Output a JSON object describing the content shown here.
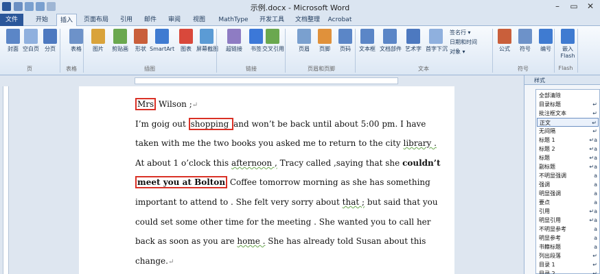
{
  "window": {
    "title": "示例.docx - Microsoft Word"
  },
  "tabs": [
    "文件",
    "开始",
    "插入",
    "页面布局",
    "引用",
    "邮件",
    "审阅",
    "视图",
    "MathType",
    "开发工具",
    "文档整理",
    "Acrobat"
  ],
  "ribbon": {
    "groups": [
      {
        "label": "页",
        "buttons": [
          "封面",
          "空白页",
          "分页"
        ]
      },
      {
        "label": "表格",
        "buttons": [
          "表格"
        ]
      },
      {
        "label": "插图",
        "buttons": [
          "图片",
          "剪贴画",
          "形状",
          "SmartArt",
          "图表",
          "屏幕截图"
        ]
      },
      {
        "label": "链接",
        "buttons": [
          "超链接",
          "书签",
          "交叉引用"
        ]
      },
      {
        "label": "页眉和页脚",
        "buttons": [
          "页眉",
          "页脚",
          "页码"
        ]
      },
      {
        "label": "文本",
        "buttons": [
          "文本框",
          "文档部件",
          "艺术字",
          "首字下沉"
        ],
        "small": [
          "签名行 ▾",
          "日期和时间",
          "对象 ▾"
        ]
      },
      {
        "label": "符号",
        "buttons": [
          "公式",
          "符号",
          "编号"
        ]
      },
      {
        "label": "Flash",
        "buttons": [
          "嵌入\nFlash"
        ]
      }
    ]
  },
  "document": {
    "lines": [
      [
        {
          "t": "Mrs",
          "box": true
        },
        {
          "t": " Wilson ;"
        },
        {
          "t": "↵",
          "pm": true
        }
      ],
      [
        {
          "t": "I’m goig out "
        },
        {
          "t": "shopping ",
          "box": true
        },
        {
          "t": " and won’t be back until about 5:00 pm. I have"
        }
      ],
      [
        {
          "t": "taken with me the two books you asked me to return to the city "
        },
        {
          "t": "library .",
          "sq": true
        }
      ],
      [
        {
          "t": "At about 1 o’clock this "
        },
        {
          "t": "afternoon ,",
          "sq": true
        },
        {
          "t": " Tracy called ,saying that she "
        },
        {
          "t": "couldn’t",
          "b": true
        }
      ],
      [
        {
          "t": "meet you at Bolton",
          "box": true,
          "b": true
        },
        {
          "t": " Coffee tomorrow morning as she has something"
        }
      ],
      [
        {
          "t": "important to attend to . She felt very sorry about "
        },
        {
          "t": "that ;",
          "sq": true
        },
        {
          "t": " but said that you"
        }
      ],
      [
        {
          "t": "could set some other time for the meeting .  She wanted you to call her"
        }
      ],
      [
        {
          "t": "back as soon as you are "
        },
        {
          "t": "home .",
          "sq": true
        },
        {
          "t": " She has already told Susan about this"
        }
      ],
      [
        {
          "t": "change."
        },
        {
          "t": "↵",
          "pm": true
        }
      ]
    ]
  },
  "styles_pane": {
    "title": "样式",
    "items": [
      {
        "name": "全部清除",
        "mark": ""
      },
      {
        "name": "目录标题",
        "mark": "↵"
      },
      {
        "name": "批注框文本",
        "mark": "↵"
      },
      {
        "name": "正文",
        "mark": "↵",
        "selected": true
      },
      {
        "name": "无间隔",
        "mark": "↵"
      },
      {
        "name": "标题 1",
        "mark": "↵a"
      },
      {
        "name": "标题 2",
        "mark": "↵a"
      },
      {
        "name": "标题",
        "mark": "↵a"
      },
      {
        "name": "副标题",
        "mark": "↵a"
      },
      {
        "name": "不明显强调",
        "mark": "a"
      },
      {
        "name": "强调",
        "mark": "a"
      },
      {
        "name": "明显强调",
        "mark": "a"
      },
      {
        "name": "要点",
        "mark": "a"
      },
      {
        "name": "引用",
        "mark": "↵a"
      },
      {
        "name": "明显引用",
        "mark": "↵a"
      },
      {
        "name": "不明显参考",
        "mark": "a"
      },
      {
        "name": "明显参考",
        "mark": "a"
      },
      {
        "name": "书籍标题",
        "mark": "a"
      },
      {
        "name": "列出段落",
        "mark": "↵"
      },
      {
        "name": "目录 1",
        "mark": "↵"
      },
      {
        "name": "目录 2",
        "mark": "↵"
      }
    ]
  },
  "colors": {
    "accent": "#2b579a",
    "ribbon": "#dbe5f1",
    "markup_box": "#d93025",
    "squiggle": "#6aa84f"
  }
}
